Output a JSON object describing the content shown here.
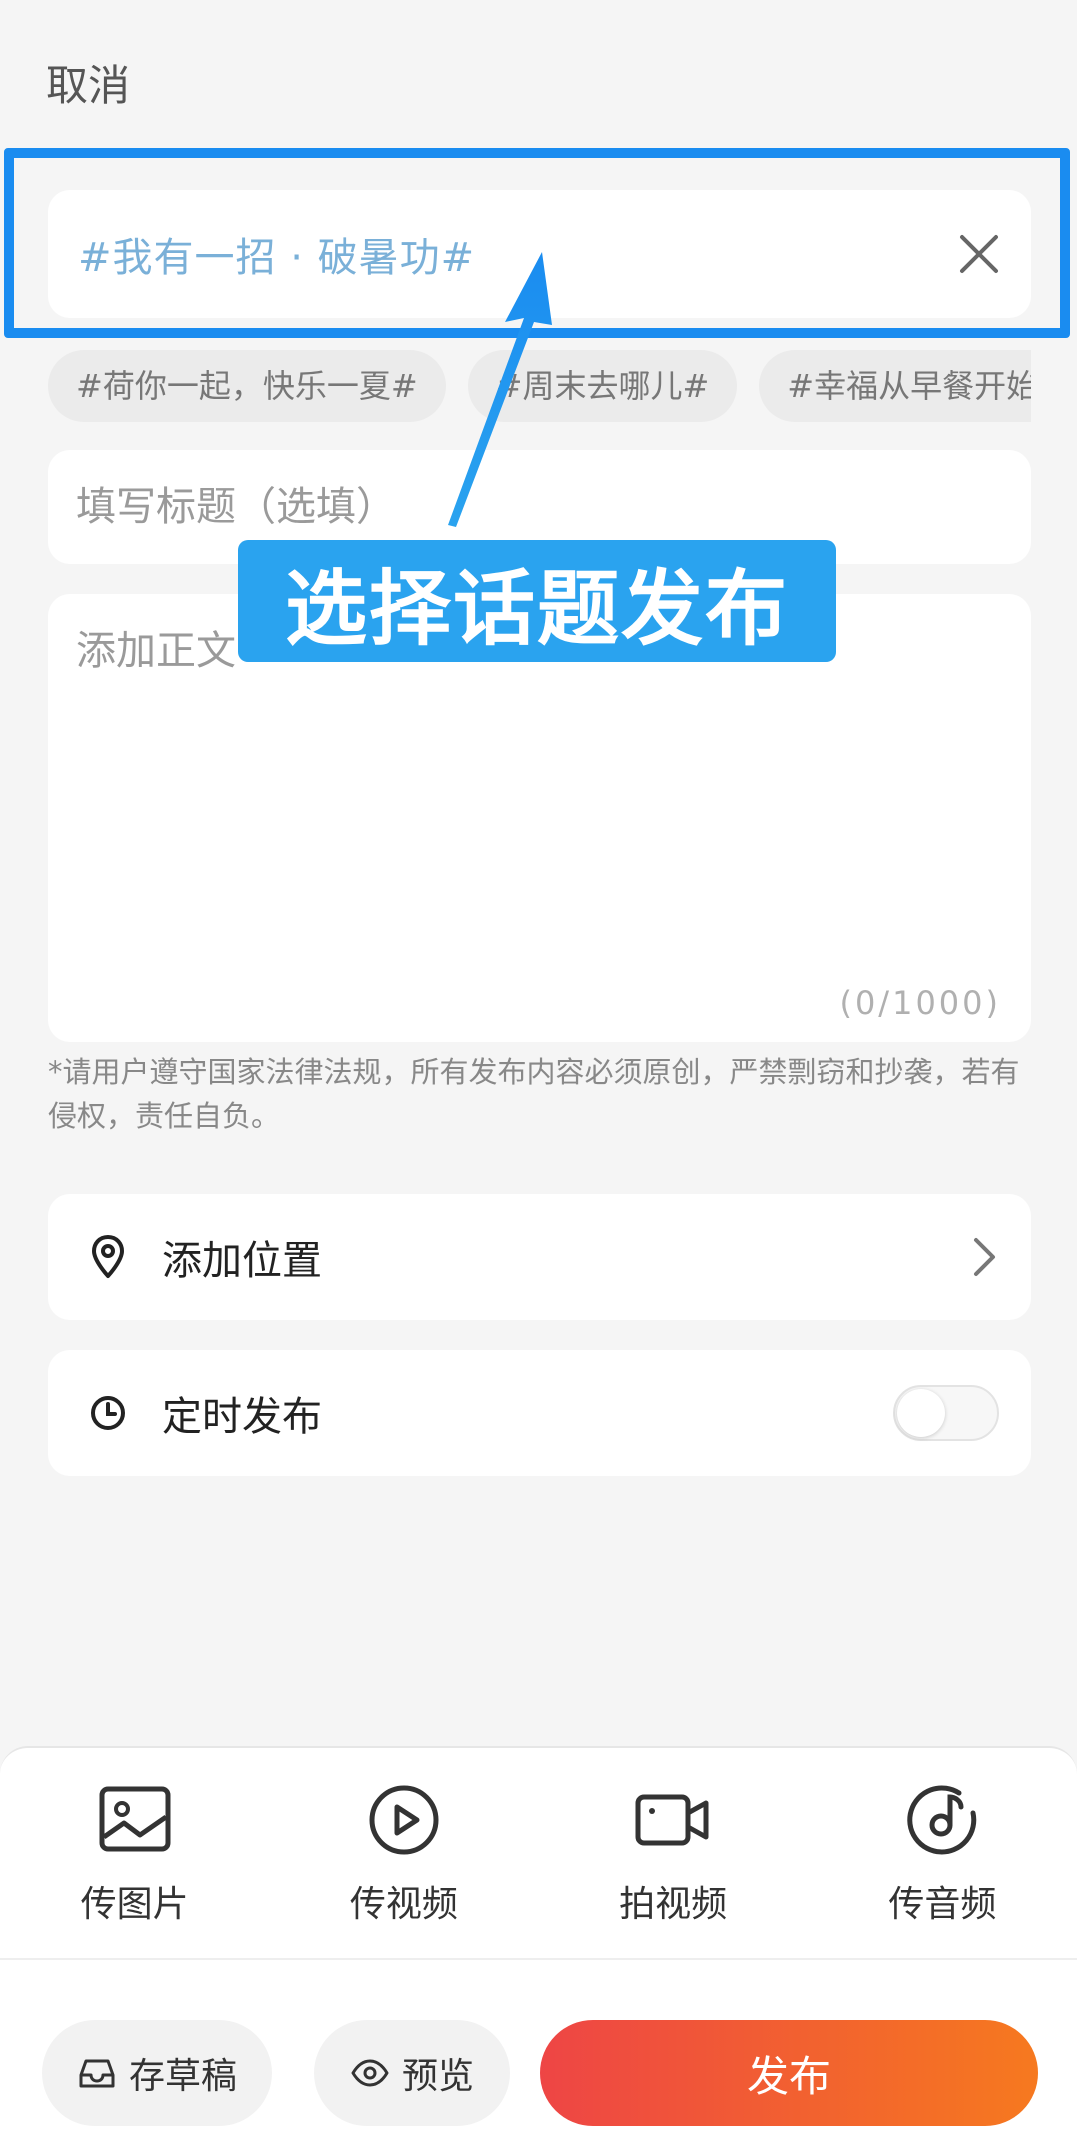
{
  "header": {
    "cancel_label": "取消"
  },
  "topic": {
    "selected": "#我有一招 · 破暑功#",
    "clear_icon": "close-icon"
  },
  "topic_suggestions": [
    "#荷你一起，快乐一夏#",
    "#周末去哪儿#",
    "#幸福从早餐开始#"
  ],
  "title_field": {
    "placeholder": "填写标题（选填）",
    "value": ""
  },
  "body_field": {
    "placeholder": "添加正文",
    "value": "",
    "counter": "(0/1000)"
  },
  "notice": "*请用户遵守国家法律法规，所有发布内容必须原创，严禁剽窃和抄袭，若有侵权，责任自负。",
  "location_row": {
    "label": "添加位置",
    "icon": "location-pin-icon"
  },
  "schedule_row": {
    "label": "定时发布",
    "icon": "clock-icon",
    "enabled": false
  },
  "annotation": {
    "callout_text": "选择话题发布",
    "accent_color": "#1a8cf0"
  },
  "tools": [
    {
      "label": "传图片",
      "icon": "image-icon"
    },
    {
      "label": "传视频",
      "icon": "play-circle-icon"
    },
    {
      "label": "拍视频",
      "icon": "video-camera-icon"
    },
    {
      "label": "传音频",
      "icon": "music-disc-icon"
    }
  ],
  "actions": {
    "draft_label": "存草稿",
    "preview_label": "预览",
    "publish_label": "发布",
    "publish_colors": [
      "#ee4545",
      "#f6791f"
    ]
  }
}
